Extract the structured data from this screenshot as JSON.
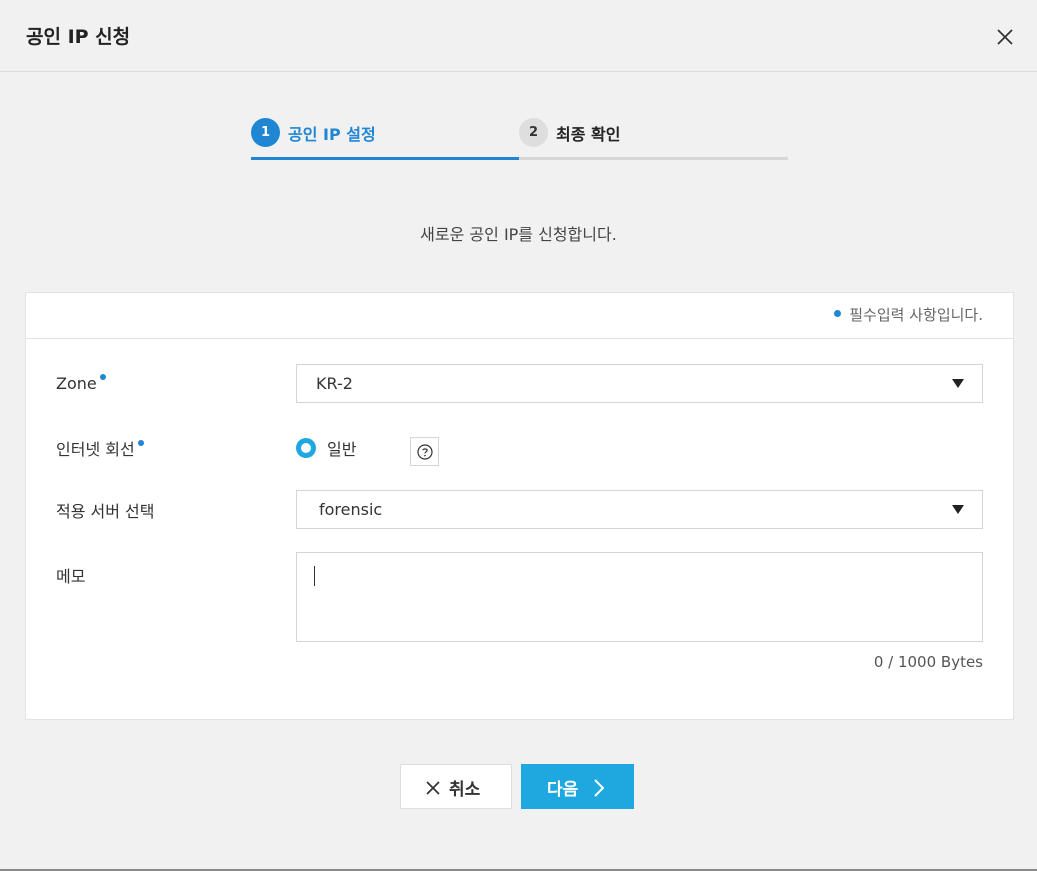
{
  "dialog": {
    "title": "공인 IP 신청",
    "close_icon": "close-icon"
  },
  "stepper": {
    "steps": [
      {
        "number": "1",
        "label": "공인 IP 설정",
        "active": true
      },
      {
        "number": "2",
        "label": "최종 확인",
        "active": false
      }
    ]
  },
  "subtitle": "새로운 공인 IP를 신청합니다.",
  "form": {
    "required_note": "필수입력 사항입니다.",
    "zone": {
      "label": "Zone",
      "value": "KR-2"
    },
    "internet_line": {
      "label": "인터넷 회선",
      "option": "일반",
      "help_icon": "question-circle-icon"
    },
    "server": {
      "label": "적용 서버 선택",
      "value": "forensic"
    },
    "memo": {
      "label": "메모",
      "value": "",
      "byte_count": "0 / 1000 Bytes"
    }
  },
  "buttons": {
    "cancel_label": "취소",
    "next_label": "다음"
  },
  "colors": {
    "primary": "#1f86d3",
    "button_accent": "#1fa8e0",
    "background": "#f1f1f1"
  }
}
